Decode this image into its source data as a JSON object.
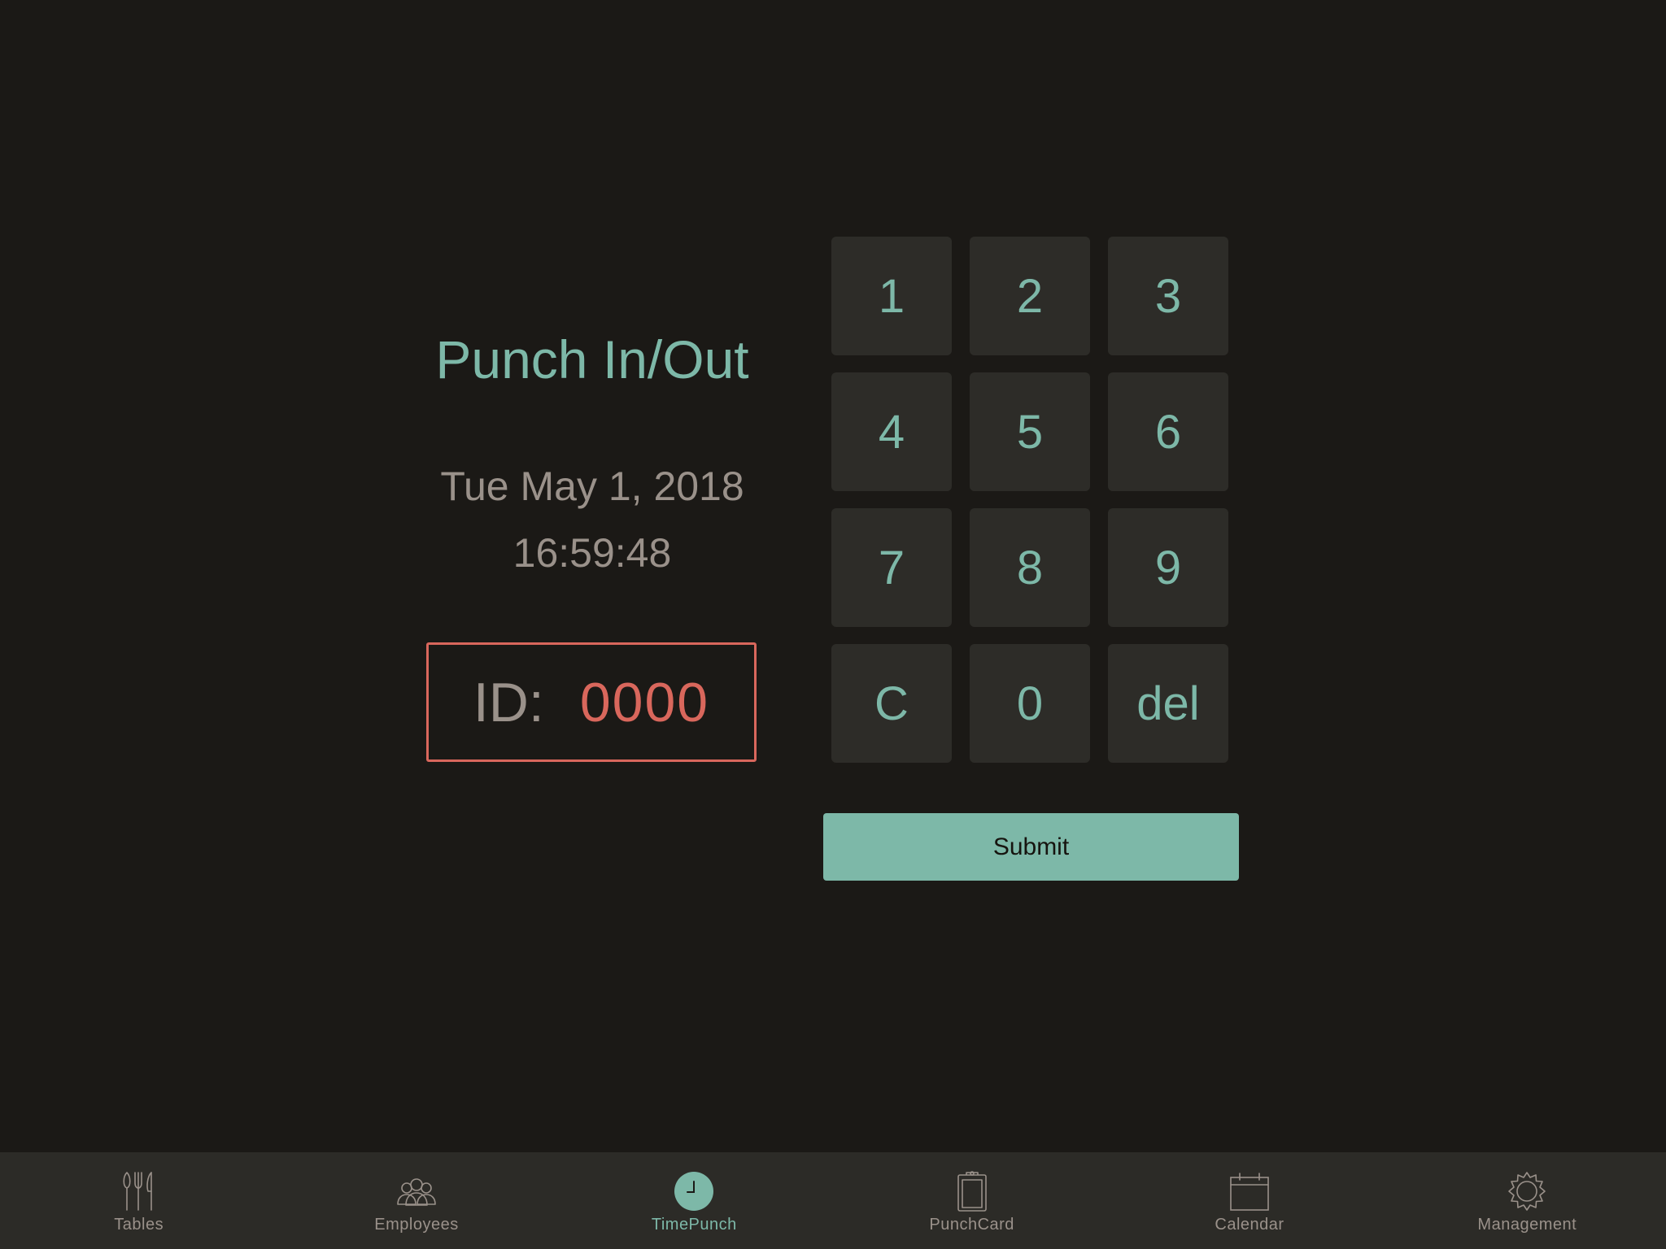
{
  "punch": {
    "title": "Punch In/Out",
    "date": "Tue May 1, 2018",
    "time": "16:59:48",
    "id_label": "ID:",
    "id_value": "0000"
  },
  "keypad": {
    "keys": [
      "1",
      "2",
      "3",
      "4",
      "5",
      "6",
      "7",
      "8",
      "9",
      "C",
      "0",
      "del"
    ],
    "submit_label": "Submit"
  },
  "tabbar": {
    "items": [
      {
        "label": "Tables",
        "icon": "utensils-icon",
        "active": false
      },
      {
        "label": "Employees",
        "icon": "people-icon",
        "active": false
      },
      {
        "label": "TimePunch",
        "icon": "clock-icon",
        "active": true
      },
      {
        "label": "PunchCard",
        "icon": "clipboard-icon",
        "active": false
      },
      {
        "label": "Calendar",
        "icon": "calendar-icon",
        "active": false
      },
      {
        "label": "Management",
        "icon": "gear-icon",
        "active": false
      }
    ]
  },
  "colors": {
    "background": "#1b1916",
    "accent": "#7db8a8",
    "id_highlight": "#d9675c",
    "muted_text": "#9a918a",
    "key_background": "#2d2c28",
    "tabbar_background": "#2c2b27"
  }
}
